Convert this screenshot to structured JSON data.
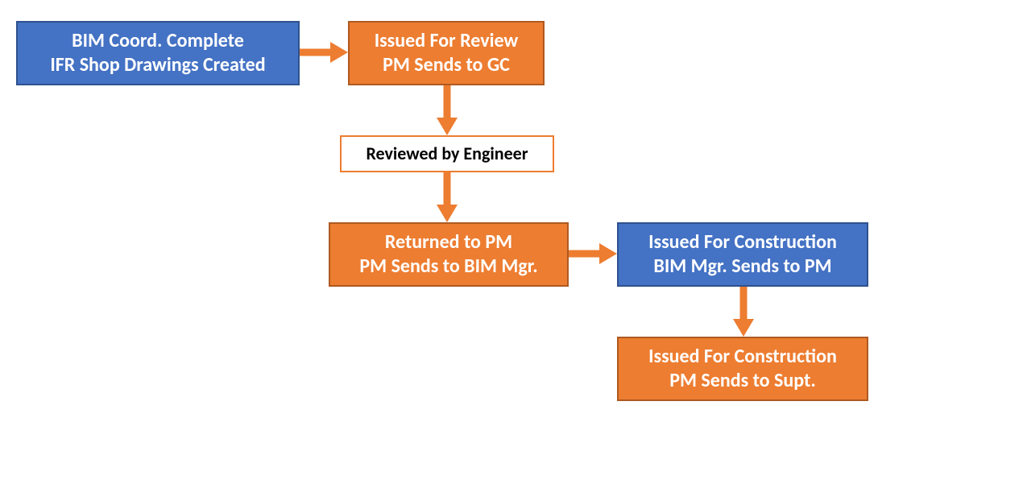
{
  "colors": {
    "blue": "#4472C4",
    "orange": "#ED7D31",
    "arrow": "#ED7D31"
  },
  "nodes": {
    "bim_complete": {
      "line1": "BIM Coord. Complete",
      "line2": "IFR Shop Drawings Created"
    },
    "issued_review": {
      "line1": "Issued For Review",
      "line2": "PM Sends to GC"
    },
    "reviewed": {
      "line1": "Reviewed by Engineer"
    },
    "returned": {
      "line1": "Returned to PM",
      "line2": "PM Sends to BIM Mgr."
    },
    "ifc_bim": {
      "line1": "Issued For Construction",
      "line2": "BIM Mgr. Sends to PM"
    },
    "ifc_pm": {
      "line1": "Issued For Construction",
      "line2": "PM Sends to Supt."
    }
  }
}
